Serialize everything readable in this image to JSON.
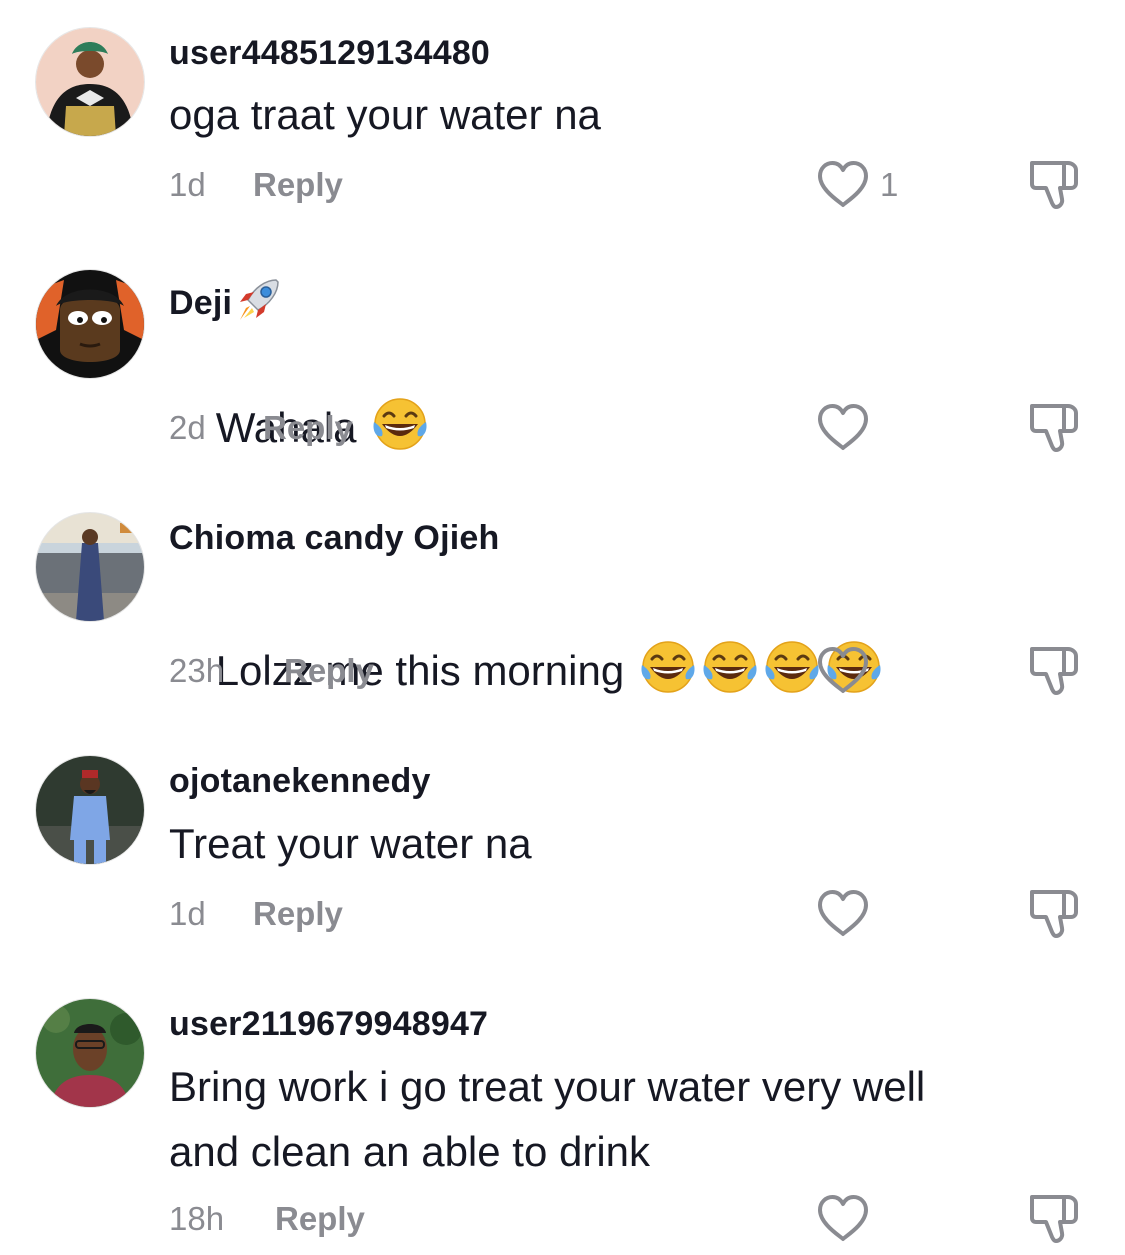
{
  "comments": [
    {
      "username": "user4485129134480",
      "text": "oga traat your water na",
      "time": "1d",
      "reply_label": "Reply",
      "like_count": "1",
      "avatar_icon": "avatar-woman-traditional-attire"
    },
    {
      "username": "Deji",
      "username_emoji": "rocket-icon",
      "text": "Wahala",
      "text_emojis": [
        "tears-of-joy-icon"
      ],
      "time": "2d",
      "reply_label": "Reply",
      "avatar_icon": "avatar-cartoon-character"
    },
    {
      "username": "Chioma candy Ojieh",
      "text": "Lolzz me this morning",
      "text_emojis": [
        "tears-of-joy-icon",
        "tears-of-joy-icon",
        "tears-of-joy-icon",
        "tears-of-joy-icon"
      ],
      "time": "23h",
      "reply_label": "Reply",
      "avatar_icon": "avatar-woman-by-car"
    },
    {
      "username": "ojotanekennedy",
      "text": "Treat your water na",
      "time": "1d",
      "reply_label": "Reply",
      "avatar_icon": "avatar-man-standing"
    },
    {
      "username": "user2119679948947",
      "text": "Bring work i go treat your water very well\nand clean an able to drink",
      "time": "18h",
      "reply_label": "Reply",
      "avatar_icon": "avatar-man-portrait"
    }
  ],
  "colors": {
    "text": "#161823",
    "muted": "#8a8b91",
    "background": "#ffffff"
  }
}
